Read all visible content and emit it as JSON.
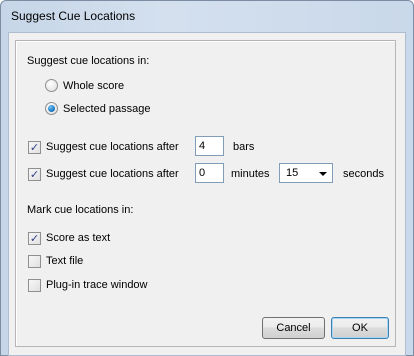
{
  "window": {
    "title": "Suggest Cue Locations"
  },
  "section_suggest": {
    "heading": "Suggest cue locations in:",
    "options": [
      {
        "label": "Whole score",
        "checked": false
      },
      {
        "label": "Selected passage",
        "checked": true
      }
    ]
  },
  "after_bars": {
    "label": "Suggest cue locations after",
    "checked": true,
    "value": "4",
    "unit": "bars"
  },
  "after_time": {
    "label": "Suggest cue locations after",
    "checked": true,
    "minutes_value": "0",
    "minutes_unit": "minutes",
    "seconds_value": "15",
    "seconds_unit": "seconds"
  },
  "section_mark": {
    "heading": "Mark cue locations in:",
    "options": [
      {
        "label": "Score as text",
        "checked": true
      },
      {
        "label": "Text file",
        "checked": false
      },
      {
        "label": "Plug-in trace window",
        "checked": false
      }
    ]
  },
  "buttons": {
    "cancel": "Cancel",
    "ok": "OK"
  },
  "check_glyph": "✓"
}
